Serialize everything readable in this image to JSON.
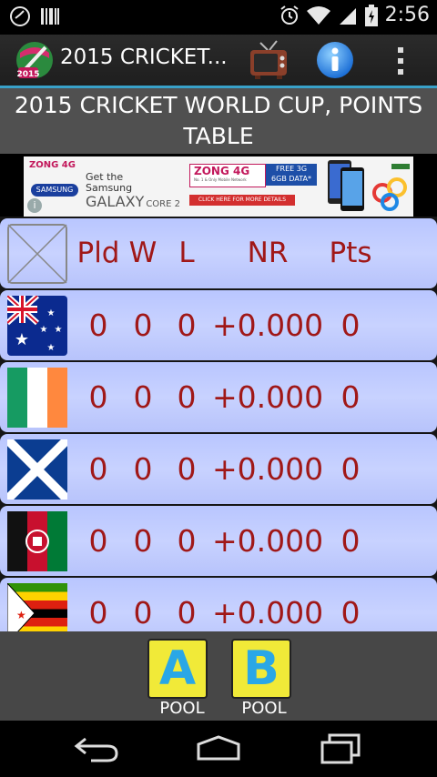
{
  "status": {
    "time": "2:56"
  },
  "appbar": {
    "title": "2015 CRICKET..."
  },
  "header": {
    "line1": "2015 CRICKET WORLD CUP, POINTS",
    "line2": "TABLE"
  },
  "ad": {
    "brand": "ZONG 4G",
    "samsung": "SAMSUNG",
    "get_the": "Get the",
    "samsung_text": "Samsung",
    "galaxy": "GALAXY",
    "core": "CORE 2",
    "tagline": "No. 1 & Only Mobile Network",
    "free": "FREE 3G",
    "data": "6GB DATA*",
    "cta": "CLICK HERE FOR MORE DETAILS",
    "info": "i"
  },
  "table": {
    "headers": {
      "pld": "Pld",
      "w": "W",
      "l": "L",
      "nr": "NR",
      "pts": "Pts"
    },
    "rows": [
      {
        "flag": "australia-flag",
        "pld": "0",
        "w": "0",
        "l": "0",
        "nr": "+0.000",
        "pts": "0"
      },
      {
        "flag": "ireland-flag",
        "pld": "0",
        "w": "0",
        "l": "0",
        "nr": "+0.000",
        "pts": "0"
      },
      {
        "flag": "scotland-flag",
        "pld": "0",
        "w": "0",
        "l": "0",
        "nr": "+0.000",
        "pts": "0"
      },
      {
        "flag": "afghanistan-flag",
        "pld": "0",
        "w": "0",
        "l": "0",
        "nr": "+0.000",
        "pts": "0"
      },
      {
        "flag": "zimbabwe-flag",
        "pld": "0",
        "w": "0",
        "l": "0",
        "nr": "+0.000",
        "pts": "0"
      }
    ]
  },
  "pools": [
    {
      "letter": "A",
      "label": "POOL"
    },
    {
      "letter": "B",
      "label": "POOL"
    }
  ],
  "colors": {
    "accent": "#38a0c8",
    "row": "#c0ccff",
    "value_text": "#a01818",
    "pool_button": "#f1ea38",
    "pool_letter": "#2aa7e6"
  }
}
